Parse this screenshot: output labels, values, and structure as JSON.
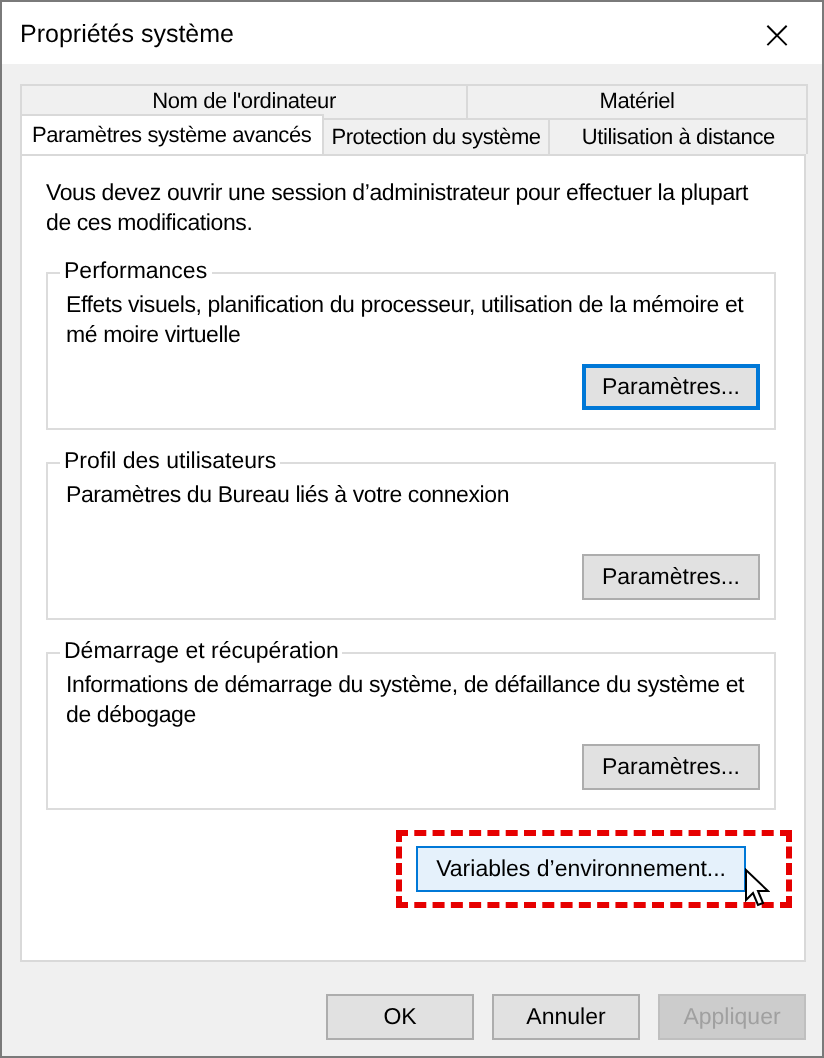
{
  "window": {
    "title": "Propriétés système",
    "close": "×"
  },
  "tab_rows": [
    [
      {
        "label": "Nom de l'ordinateur",
        "selected": false
      },
      {
        "label": "Matériel",
        "selected": false
      }
    ],
    [
      {
        "label": "Paramètres système avancés",
        "selected": true
      },
      {
        "label": "Protection du système",
        "selected": false
      },
      {
        "label": "Utilisation à distance",
        "selected": false
      }
    ]
  ],
  "notice": "Vous devez ouvrir une session d’administrateur pour effectuer la plupart de ces modifications.",
  "groups": [
    {
      "title": "Performances",
      "text": "Effets visuels, planification du processeur, utilisation de la mémoire et mé moire virtuelle",
      "button": {
        "label": "Paramètres...",
        "focused": true
      }
    },
    {
      "title": "Profil des utilisateurs",
      "text": "Paramètres du Bureau liés à votre connexion",
      "button": {
        "label": "Paramètres...",
        "focused": false
      }
    },
    {
      "title": "Démarrage et récupération",
      "text": "Informations de démarrage du système, de défaillance du système et de débogage",
      "button": {
        "label": "Paramètres...",
        "focused": false
      }
    }
  ],
  "env_button": {
    "label": "Variables d’environnement...",
    "hovered": true,
    "highlighted": true
  },
  "buttons": [
    {
      "label": "OK",
      "disabled": false
    },
    {
      "label": "Annuler",
      "disabled": false
    },
    {
      "label": "Appliquer",
      "disabled": true
    }
  ]
}
